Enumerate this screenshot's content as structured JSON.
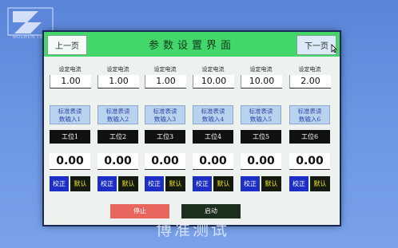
{
  "watermark": {
    "brand_caption": "BOZHUN TEST",
    "bottom_text": "博准测试"
  },
  "header": {
    "title": "参数设置界面",
    "prev_label": "上一页",
    "next_label": "下一页"
  },
  "columns": [
    {
      "set_label": "设定电流",
      "set_value": "1.00",
      "std_line1": "标准表读",
      "std_line2": "数输入1",
      "station": "工位1",
      "reading": "0.00",
      "calib": "校正",
      "default": "默认"
    },
    {
      "set_label": "设定电流",
      "set_value": "1.00",
      "std_line1": "标准表读",
      "std_line2": "数输入2",
      "station": "工位2",
      "reading": "0.00",
      "calib": "校正",
      "default": "默认"
    },
    {
      "set_label": "设定电流",
      "set_value": "1.00",
      "std_line1": "标准表读",
      "std_line2": "数输入3",
      "station": "工位3",
      "reading": "0.00",
      "calib": "校正",
      "default": "默认"
    },
    {
      "set_label": "设定电流",
      "set_value": "10.00",
      "std_line1": "标准表读",
      "std_line2": "数输入4",
      "station": "工位4",
      "reading": "0.00",
      "calib": "校正",
      "default": "默认"
    },
    {
      "set_label": "设定电流",
      "set_value": "10.00",
      "std_line1": "标准表读",
      "std_line2": "数输入5",
      "station": "工位5",
      "reading": "0.00",
      "calib": "校正",
      "default": "默认"
    },
    {
      "set_label": "设定电流",
      "set_value": "2.00",
      "std_line1": "标准表读",
      "std_line2": "数输入6",
      "station": "工位6",
      "reading": "0.00",
      "calib": "校正",
      "default": "默认"
    }
  ],
  "controls": {
    "stop_label": "停止",
    "start_label": "启动"
  },
  "colors": {
    "header_bg": "#43d66a",
    "calib_bg": "#1c2ec4",
    "default_bg": "#151a10",
    "stop_bg": "#e8665d"
  }
}
